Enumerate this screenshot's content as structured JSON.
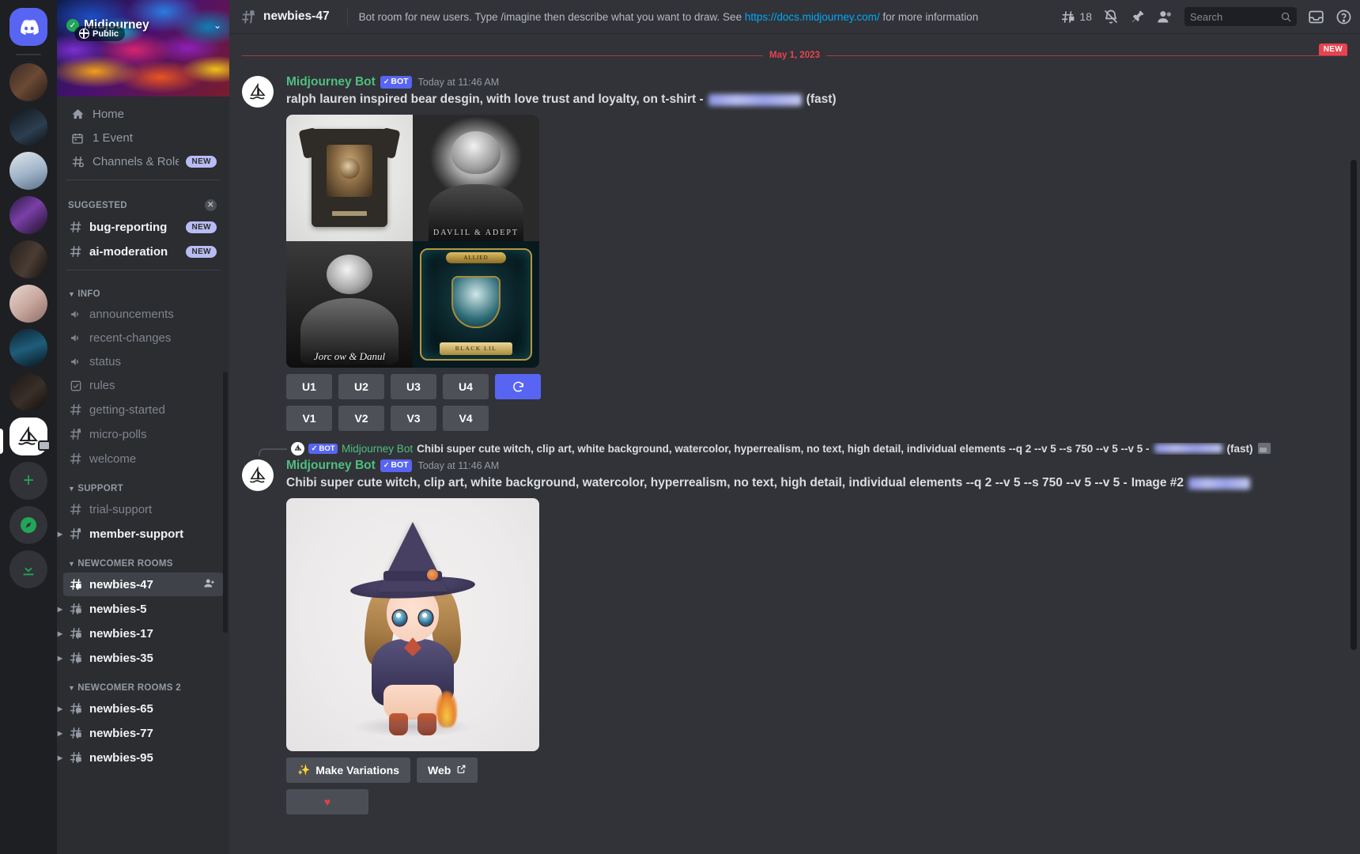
{
  "server_rail": {
    "items": [
      {
        "name": "discord-home",
        "icon": "discord-logo"
      },
      {
        "name": "server-1",
        "icon": "server-thumb"
      },
      {
        "name": "server-2",
        "icon": "server-thumb"
      },
      {
        "name": "server-3",
        "icon": "server-thumb"
      },
      {
        "name": "server-4",
        "icon": "server-thumb"
      },
      {
        "name": "server-5",
        "icon": "server-thumb"
      },
      {
        "name": "server-6",
        "icon": "server-thumb"
      },
      {
        "name": "server-7",
        "icon": "server-thumb"
      },
      {
        "name": "server-8",
        "icon": "server-thumb"
      }
    ],
    "active_server": "Midjourney",
    "add_server_label": "+",
    "explore_label": "compass-icon",
    "download_label": "download-icon"
  },
  "sidebar": {
    "guild": {
      "name": "Midjourney",
      "verified": true,
      "privacy_label": "Public",
      "chevron": "⌄"
    },
    "nav": [
      {
        "label": "Home",
        "icon": "home-icon"
      },
      {
        "label": "1 Event",
        "icon": "calendar-icon"
      },
      {
        "label": "Channels & Roles",
        "icon": "channels-roles-icon",
        "badge": "NEW"
      }
    ],
    "sections": [
      {
        "title": "SUGGESTED",
        "dismissible": true,
        "channels": [
          {
            "name": "bug-reporting",
            "icon": "hash-icon",
            "badge": "NEW",
            "state": "unread"
          },
          {
            "name": "ai-moderation",
            "icon": "hash-icon",
            "badge": "NEW",
            "state": "unread"
          }
        ]
      },
      {
        "title": "INFO",
        "channels": [
          {
            "name": "announcements",
            "icon": "announcement-icon",
            "state": "dim"
          },
          {
            "name": "recent-changes",
            "icon": "announcement-icon",
            "state": "dim"
          },
          {
            "name": "status",
            "icon": "announcement-icon",
            "state": "dim"
          },
          {
            "name": "rules",
            "icon": "rules-icon",
            "state": "dim"
          },
          {
            "name": "getting-started",
            "icon": "hash-icon",
            "state": "dim"
          },
          {
            "name": "micro-polls",
            "icon": "hash-thread-icon",
            "state": "dim"
          },
          {
            "name": "welcome",
            "icon": "hash-icon",
            "state": "dim"
          }
        ]
      },
      {
        "title": "SUPPORT",
        "channels": [
          {
            "name": "trial-support",
            "icon": "hash-icon",
            "state": "dim"
          },
          {
            "name": "member-support",
            "icon": "hash-thread-icon",
            "state": "unread",
            "expandable": true
          }
        ]
      },
      {
        "title": "NEWCOMER ROOMS",
        "channels": [
          {
            "name": "newbies-47",
            "icon": "hash-forum-icon",
            "state": "active",
            "invite": "add-member-icon"
          },
          {
            "name": "newbies-5",
            "icon": "hash-forum-icon",
            "state": "unread",
            "expandable": true
          },
          {
            "name": "newbies-17",
            "icon": "hash-forum-icon",
            "state": "unread",
            "expandable": true
          },
          {
            "name": "newbies-35",
            "icon": "hash-forum-icon",
            "state": "unread",
            "expandable": true
          }
        ]
      },
      {
        "title": "NEWCOMER ROOMS 2",
        "channels": [
          {
            "name": "newbies-65",
            "icon": "hash-forum-icon",
            "state": "unread",
            "expandable": true
          },
          {
            "name": "newbies-77",
            "icon": "hash-forum-icon",
            "state": "unread",
            "expandable": true
          },
          {
            "name": "newbies-95",
            "icon": "hash-forum-icon",
            "state": "unread",
            "expandable": true
          }
        ]
      }
    ]
  },
  "topbar": {
    "channel_name": "newbies-47",
    "topic_before": "Bot room for new users. Type /imagine then describe what you want to draw. See ",
    "topic_link": "https://docs.midjourney.com/",
    "topic_after": " for more information",
    "threads_count": "18",
    "icons": [
      "threads-icon",
      "notification-off-icon",
      "pinned-messages-icon",
      "member-list-icon",
      "inbox-icon",
      "help-icon"
    ],
    "search_placeholder": "Search"
  },
  "messages": {
    "date_divider": "May 1, 2023",
    "new_badge": "NEW",
    "items": [
      {
        "author": "Midjourney Bot",
        "bot_tag": "BOT",
        "bot_check": "✓",
        "timestamp": "Today at 11:46 AM",
        "text": "ralph lauren inspired bear desgin, with love trust and loyalty, on t-shirt -",
        "suffix": "(fast)",
        "images": [
          {
            "alt": "bear-tshirt-mockup"
          },
          {
            "alt": "bear-portrait-bw",
            "caption": "DAVLIL & ADEPT"
          },
          {
            "alt": "bear-heart-bw",
            "caption": "Jorc ow & Danul"
          },
          {
            "alt": "bear-crest-emblem",
            "caption_top": "ALLIED",
            "caption_bottom": "BLACK LIL"
          }
        ],
        "upscale_buttons": [
          "U1",
          "U2",
          "U3",
          "U4"
        ],
        "reroll_button": "🔄",
        "variation_buttons": [
          "V1",
          "V2",
          "V3",
          "V4"
        ]
      },
      {
        "reply_reference": {
          "bot_tag": "BOT",
          "bot_check": "✓",
          "author": "Midjourney Bot",
          "text": "Chibi super cute witch, clip art, white background, watercolor, hyperrealism, no text, high detail, individual elements --q 2 --v 5 --s 750 --v 5 --v 5 -",
          "suffix": "(fast)"
        },
        "author": "Midjourney Bot",
        "bot_tag": "BOT",
        "bot_check": "✓",
        "timestamp": "Today at 11:46 AM",
        "text": "Chibi super cute witch, clip art, white background, watercolor, hyperrealism, no text, high detail, individual elements --q 2 --v 5 --s 750 --v 5 --v 5 -",
        "image_label": "Image #2",
        "images": [
          {
            "alt": "chibi-witch-watercolor"
          }
        ],
        "actions": [
          {
            "label": "Make Variations",
            "icon": "sparkle-icon"
          },
          {
            "label": "Web",
            "icon": "external-link-icon"
          }
        ]
      }
    ]
  },
  "colors": {
    "accent_blurple": "#5865f2",
    "online_green": "#23a559",
    "bot_green": "#4fbf7e",
    "date_red": "#e8434f",
    "link_blue": "#00a8fc",
    "sidebar_bg": "#2b2d31",
    "main_bg": "#313338",
    "rail_bg": "#1e1f22"
  }
}
